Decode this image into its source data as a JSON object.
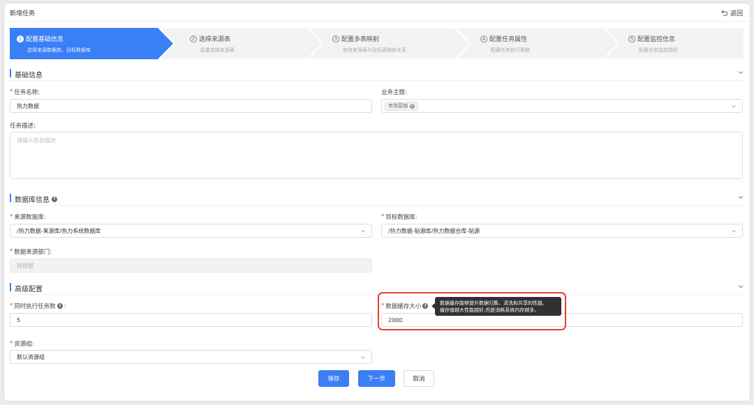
{
  "header": {
    "title": "新增任务",
    "back_label": "返回"
  },
  "steps": [
    {
      "num": "1",
      "title": "配置基础信息",
      "sub": "选择来源数据库、目标数据库",
      "active": true
    },
    {
      "num": "2",
      "title": "选择来源表",
      "sub": "批量选择来源表",
      "active": false
    },
    {
      "num": "3",
      "title": "配置多表映射",
      "sub": "修改来源表与目标表映射关系",
      "active": false
    },
    {
      "num": "4",
      "title": "配置任务属性",
      "sub": "配置任务执行策略",
      "active": false
    },
    {
      "num": "5",
      "title": "配置监控信息",
      "sub": "配置任务监控指标",
      "active": false
    }
  ],
  "sections": {
    "basic": "基础信息",
    "database": "数据库信息",
    "advanced": "高级配置"
  },
  "form": {
    "task_name": {
      "label": "任务名称:",
      "value": "热力数据"
    },
    "business_topic": {
      "label": "业务主题:",
      "tag": "市场营销"
    },
    "task_desc": {
      "label": "任务描述:",
      "placeholder": "请输入任务描述"
    },
    "source_db": {
      "label": "来源数据库:",
      "value": "/热力数据-来源库/热力系统数据库"
    },
    "target_db": {
      "label": "目标数据库:",
      "value": "/热力数据-贴源库/热力数据仓库-贴源"
    },
    "source_dept": {
      "label": "数据来源部门:",
      "value": "项目部"
    },
    "concurrency": {
      "label": "同时执行任务数",
      "colon": ":",
      "value": "5"
    },
    "cache_size": {
      "label": "数据缓存大小",
      "value": "2000"
    },
    "resource_group": {
      "label": "资源组:",
      "value": "默认资源组"
    }
  },
  "tooltip": {
    "line1": "数据缓存能够提升数据归集、清洗和共享的性能,",
    "line2": "缓存值越大性能越好,但是消耗系统内存越多。"
  },
  "buttons": {
    "save": "保存",
    "next": "下一步",
    "cancel": "取消"
  },
  "colors": {
    "primary": "#3a7ff5",
    "required": "#e2483a",
    "highlight": "#e0422f",
    "tooltip_bg": "#303133"
  }
}
